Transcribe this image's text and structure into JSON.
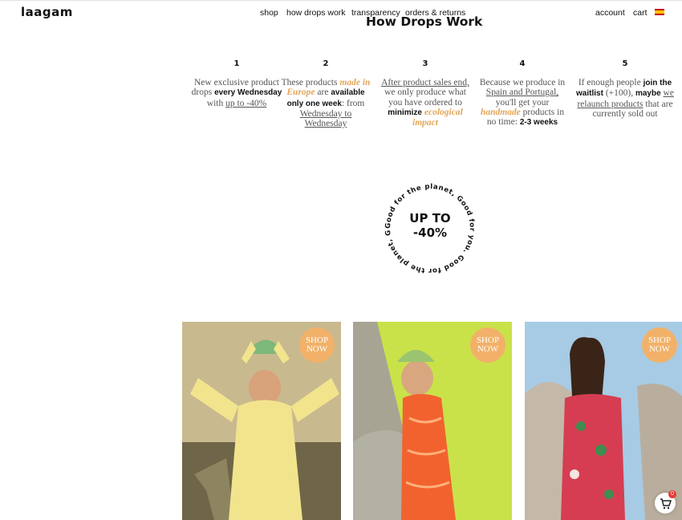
{
  "header": {
    "logo": "laagam",
    "nav": [
      "shop",
      "how drops work",
      "transparency",
      "orders & returns"
    ],
    "account": "account",
    "cart": "cart"
  },
  "title": "How Drops Work",
  "steps": [
    {
      "num": "1",
      "t1": "New exclusive product drops",
      "b1": "every Wednesday",
      "t2": "with",
      "u1": "up to -40%"
    },
    {
      "num": "2",
      "t1": "These products",
      "e1": "made in Europe",
      "t2": "are",
      "b1": "available only one week",
      "t3": ": from",
      "u1": "Wednesday to Wednesday"
    },
    {
      "num": "3",
      "u1": "After product sales end,",
      "t1": "we only produce what you have ordered to",
      "b1": "minimize",
      "e1": "ecological impact"
    },
    {
      "num": "4",
      "t1": "Because we produce in",
      "u1": "Spain and Portugal,",
      "t2": "you'll get your",
      "e1": "handmade",
      "t3": "products in no time:",
      "b1": "2-3 weeks"
    },
    {
      "num": "5",
      "t1": "If enough people",
      "b1": "join the waitlist",
      "t2": "(+100),",
      "b2": "maybe",
      "u1": "we relaunch products",
      "t3": "that are currently sold out"
    }
  ],
  "badge": {
    "line1": "UP TO",
    "line2": "-40%",
    "ring": "Good for the planet, Good for you. Good for the planet, Good for you."
  },
  "products": [
    {
      "shop": "SHOP NOW",
      "sky": "#c9b98f",
      "ground": "#6f6548",
      "dress": "#f1e48d",
      "hat": "#7cb87a"
    },
    {
      "shop": "SHOP NOW",
      "sky": "#a8a493",
      "ground": "#b3b0a4",
      "dress": "#f2622f",
      "hat": "#9ac46f"
    },
    {
      "shop": "SHOP NOW",
      "sky": "#a7cbe4",
      "ground": "#c4b9a8",
      "dress": "#d63d52",
      "hat": "#3f8e4f"
    }
  ],
  "cart_count": "0",
  "colors": {
    "accent": "#e3a658",
    "badge": "#f2b169",
    "text": "#111111"
  }
}
